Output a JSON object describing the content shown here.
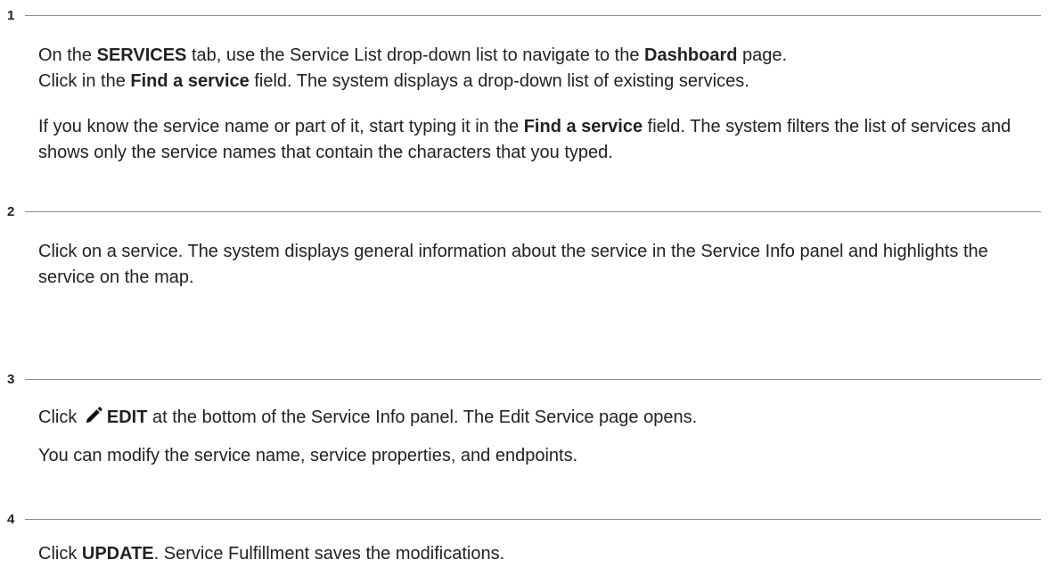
{
  "steps": [
    {
      "number": "1",
      "paragraphs": [
        {
          "line1": [
            "On the ",
            "SERVICES",
            " tab, use the Service List drop-down list to navigate to the ",
            "Dashboard",
            " page."
          ],
          "line2": [
            "Click in the ",
            "Find a service",
            " field. The system displays a drop-down list of existing services."
          ]
        },
        {
          "text": [
            "If you know the service name or part of it, start typing it in the ",
            "Find a service",
            " field. The system filters the list of services and shows only the service names that contain the characters that you typed."
          ]
        }
      ]
    },
    {
      "number": "2",
      "paragraphs": [
        {
          "text": "Click on a service. The system displays general information about the service in the Service Info panel and highlights the service on the map."
        }
      ]
    },
    {
      "number": "3",
      "paragraphs": [
        {
          "text": [
            "Click ",
            "EDIT",
            " at the bottom of the Service Info panel. The Edit Service page opens."
          ],
          "icon": "pencil-icon"
        },
        {
          "text": "You can modify the service name, service properties, and endpoints."
        }
      ]
    },
    {
      "number": "4",
      "paragraphs": [
        {
          "text": [
            "Click ",
            "UPDATE",
            ". Service Fulfillment saves the modifications."
          ]
        }
      ]
    }
  ]
}
